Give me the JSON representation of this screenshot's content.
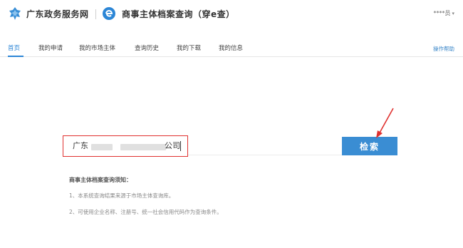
{
  "header": {
    "gov_name": "广东政务服务网",
    "app_name": "商事主体档案查询（穿e查）",
    "user_name": "****员",
    "gov_logo_icon": "gd-gov-logo-icon",
    "app_logo_icon": "e-query-logo-icon",
    "caret_icon": "chevron-down-icon"
  },
  "nav": {
    "items": [
      {
        "label": "首页"
      },
      {
        "label": "我的申请"
      },
      {
        "label": "我的市场主体"
      },
      {
        "label": "查询历史"
      },
      {
        "label": "我的下载"
      },
      {
        "label": "我的信息"
      }
    ],
    "help_label": "操作帮助"
  },
  "search": {
    "prefix": "广东",
    "suffix": "公司",
    "button_label": "检索"
  },
  "notice": {
    "title": "商事主体档案查询须知：",
    "items": [
      "1、本系统查询结果来源于市场主体查询库。",
      "2、可使用企业名称、注册号、统一社会信用代码作为查询条件。"
    ]
  },
  "colors": {
    "accent": "#2c86d6",
    "button": "#3a8dd3",
    "highlight_border": "#e0312f",
    "annotation_arrow": "#e0312f"
  }
}
